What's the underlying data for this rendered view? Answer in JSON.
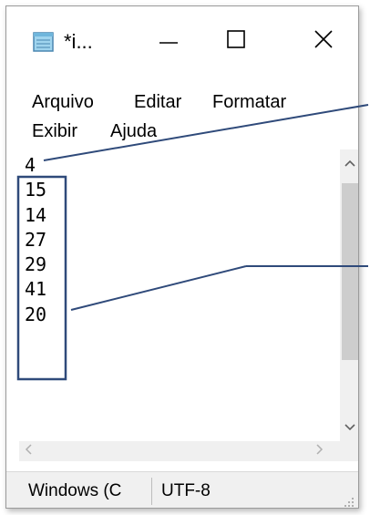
{
  "window": {
    "title": "*i...",
    "controls": {
      "minimize": "—",
      "maximize": "☐",
      "close": "✕"
    }
  },
  "menu": {
    "items": [
      "Arquivo",
      "Editar",
      "Formatar",
      "Exibir",
      "Ajuda"
    ]
  },
  "editor": {
    "lines": [
      "4",
      "15",
      "14",
      "27",
      "29",
      "41",
      "20"
    ]
  },
  "scrollbars": {
    "vertical": {
      "up_arrow": "^",
      "down_arrow": "v"
    },
    "horizontal": {
      "left_arrow": "<",
      "right_arrow": ">"
    }
  },
  "statusbar": {
    "encoding_label": "Windows (C",
    "charset": "UTF-8"
  },
  "annotation": {
    "line_color": "#2f4a7a",
    "box_color": "#2f4a7a"
  }
}
